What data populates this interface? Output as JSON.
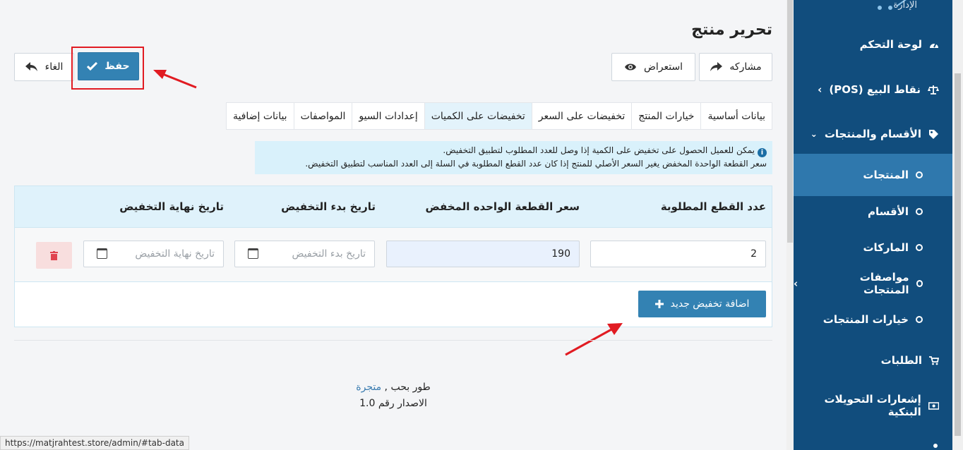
{
  "page": {
    "title": "تحرير منتج"
  },
  "toolbar": {
    "save_label": "حفظ",
    "cancel_label": "الغاء",
    "preview_label": "استعراض",
    "share_label": "مشاركه"
  },
  "tabs": [
    {
      "label": "بيانات أساسية"
    },
    {
      "label": "خيارات المنتج"
    },
    {
      "label": "تخفيضات على السعر"
    },
    {
      "label": "تخفيضات على الكميات"
    },
    {
      "label": "إعدادات السيو"
    },
    {
      "label": "المواصفات"
    },
    {
      "label": "بيانات إضافية"
    }
  ],
  "info": {
    "line1": "يمكن للعميل الحصول على تخفيض على الكمية إذا وصل للعدد المطلوب لتطبيق التخفيض.",
    "line2": "سعر القطعة الواحدة المخفض يغير السعر الأصلي للمنتج إذا كان عدد القطع المطلوبة في السلة إلى العدد المناسب لتطبيق التخفيض."
  },
  "table": {
    "headers": [
      "عدد القطع المطلوبة",
      "سعر القطعة الواحده المخفض",
      "تاريخ بدء التخفيض",
      "تاريخ نهاية التخفيض"
    ],
    "row": {
      "quantity": "2",
      "price": "190",
      "start_placeholder": "تاريخ بدء التخفيض",
      "end_placeholder": "تاريخ نهاية التخفيض"
    },
    "add_label": "اضافة تخفيض جديد"
  },
  "footer": {
    "developed_by": "طور بحب ,",
    "brand": "متجرة",
    "version": "الاصدار رقم 1.0"
  },
  "status_url": "https://matjrahtest.store/admin/#tab-data",
  "sidebar": {
    "admin_label": "الإدارة",
    "items": [
      {
        "label": "لوحة التحكم",
        "icon": "dashboard-icon"
      },
      {
        "label": "نقاط البيع (POS)",
        "icon": "scale-icon"
      },
      {
        "label": "الأقسام والمنتجات",
        "icon": "tag-icon"
      },
      {
        "label": "المنتجات"
      },
      {
        "label": "الأقسام"
      },
      {
        "label": "الماركات"
      },
      {
        "label": "مواصفات المنتجات"
      },
      {
        "label": "خيارات المنتجات"
      },
      {
        "label": "الطلبات",
        "icon": "cart-icon"
      },
      {
        "label": "إشعارات التحويلات البنكية",
        "icon": "money-icon"
      }
    ]
  },
  "colors": {
    "primary": "#3382b3",
    "sidebar": "#114d7d",
    "sidebar_active": "#2f78ad",
    "highlight": "#e11b22"
  }
}
